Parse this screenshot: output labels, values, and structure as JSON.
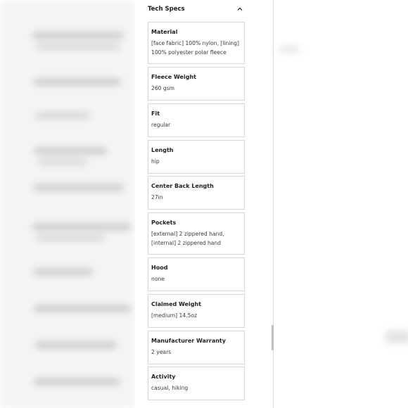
{
  "tech_specs": {
    "title": "Tech Specs",
    "toggle_icon": "chevron-up-icon",
    "items": [
      {
        "label": "Material",
        "value": "[face fabric] 100% nylon, [lining]\n100% polyester polar fleece"
      },
      {
        "label": "Fleece Weight",
        "value": "260 gsm"
      },
      {
        "label": "Fit",
        "value": "regular"
      },
      {
        "label": "Length",
        "value": "hip"
      },
      {
        "label": "Center Back Length",
        "value": "27in"
      },
      {
        "label": "Pockets",
        "value": "[external] 2 zippered hand,\n[internal] 2 zippered hand"
      },
      {
        "label": "Hood",
        "value": "none"
      },
      {
        "label": "Claimed Weight",
        "value": "[medium] 14.5oz"
      },
      {
        "label": "Manufacturer Warranty",
        "value": "2 years"
      },
      {
        "label": "Activity",
        "value": "casual, hiking"
      }
    ]
  }
}
